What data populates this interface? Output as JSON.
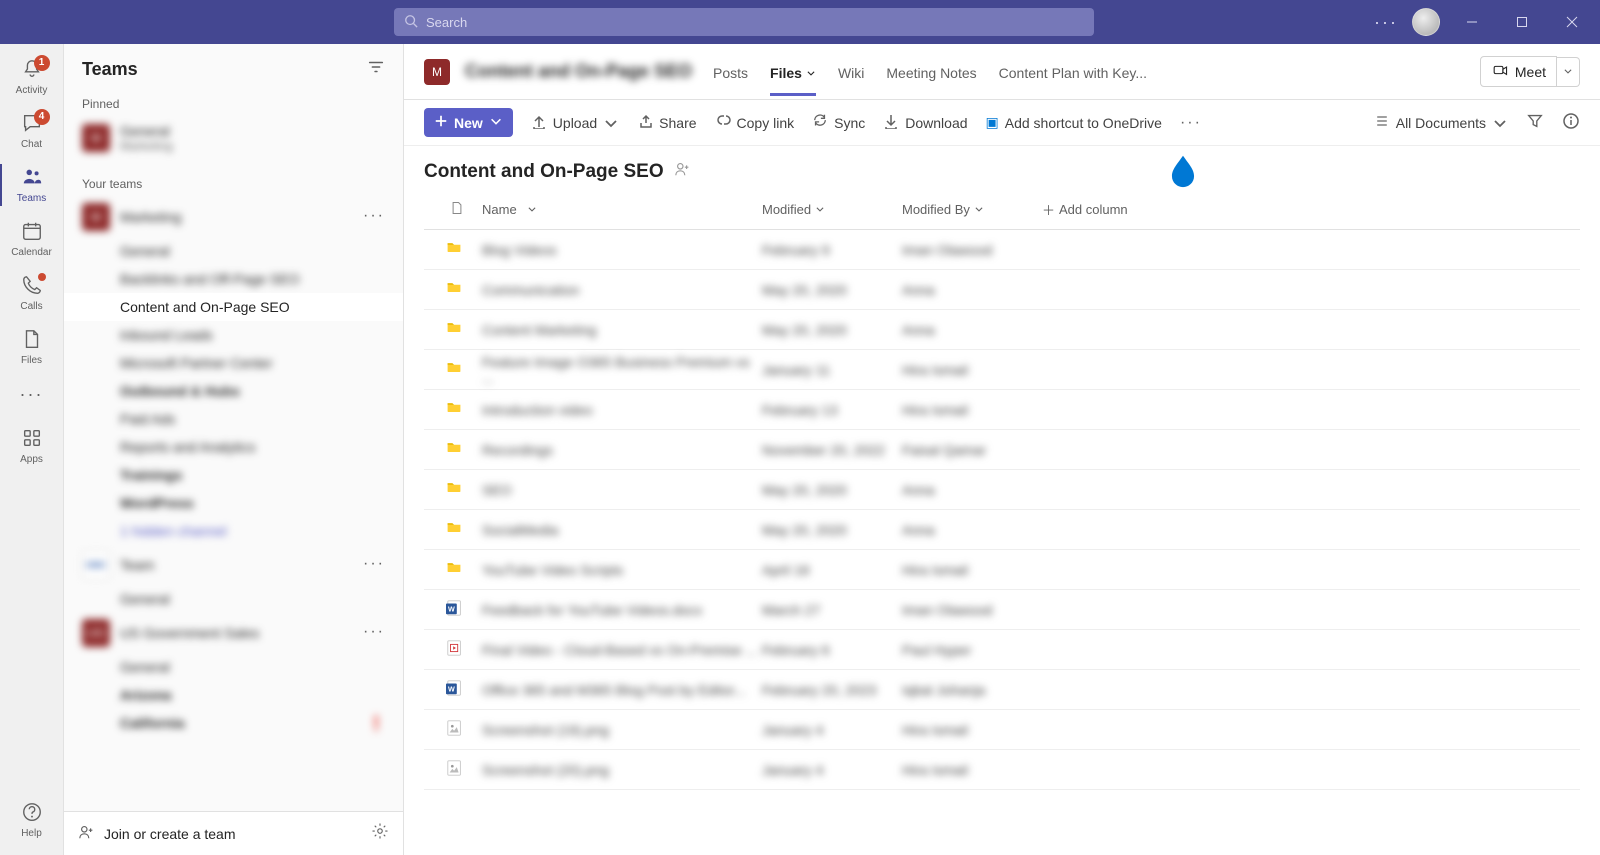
{
  "titlebar": {
    "search_placeholder": "Search"
  },
  "rail": {
    "activity": {
      "label": "Activity",
      "badge": "1"
    },
    "chat": {
      "label": "Chat",
      "badge": "4"
    },
    "teams": {
      "label": "Teams"
    },
    "calendar": {
      "label": "Calendar"
    },
    "calls": {
      "label": "Calls"
    },
    "files": {
      "label": "Files"
    },
    "apps": {
      "label": "Apps"
    },
    "help": {
      "label": "Help"
    }
  },
  "teams_panel": {
    "title": "Teams",
    "pinned_label": "Pinned",
    "pinned": [
      {
        "avatar": "M",
        "title": "General",
        "subtitle": "Marketing"
      }
    ],
    "your_teams_label": "Your teams",
    "groups": [
      {
        "avatar": "M",
        "name": "Marketing",
        "channels": [
          {
            "name": "General"
          },
          {
            "name": "Backlinks and Off-Page SEO"
          },
          {
            "name": "Content and On-Page SEO",
            "active": true
          },
          {
            "name": "Inbound Leads"
          },
          {
            "name": "Microsoft Partner Center"
          },
          {
            "name": "Outbound & Hubs",
            "bold": true
          },
          {
            "name": "Paid Ads"
          },
          {
            "name": "Reports and Analytics"
          },
          {
            "name": "Trainings",
            "bold": true
          },
          {
            "name": "WordPress",
            "bold": true
          },
          {
            "name": "1 hidden channel",
            "link": true
          }
        ]
      },
      {
        "avatar_style": "white",
        "avatar": "OMC",
        "name": "Team",
        "channels": [
          {
            "name": "General"
          }
        ]
      },
      {
        "avatar": "UG",
        "name": "US Government Sales",
        "channels": [
          {
            "name": "General"
          },
          {
            "name": "Arizona",
            "bold": true
          },
          {
            "name": "California",
            "bold": true,
            "alert": true
          }
        ]
      }
    ],
    "join_label": "Join or create a team"
  },
  "content_header": {
    "avatar": "M",
    "channel_name": "Content and On-Page SEO",
    "tabs": {
      "posts": "Posts",
      "files": "Files",
      "wiki": "Wiki",
      "notes": "Meeting Notes",
      "plan": "Content Plan with Key..."
    },
    "meet": "Meet"
  },
  "toolbar": {
    "new": "New",
    "upload": "Upload",
    "share": "Share",
    "copylink": "Copy link",
    "sync": "Sync",
    "download": "Download",
    "shortcut": "Add shortcut to OneDrive",
    "view": "All Documents"
  },
  "page": {
    "title": "Content and On-Page SEO"
  },
  "file_header": {
    "name": "Name",
    "modified": "Modified",
    "by": "Modified By",
    "add": "Add column"
  },
  "files": [
    {
      "type": "folder",
      "name": "Blog Videos",
      "modified": "February 9",
      "by": "Iman Olawood"
    },
    {
      "type": "folder",
      "name": "Communication",
      "modified": "May 20, 2020",
      "by": "Anna"
    },
    {
      "type": "folder",
      "name": "Content Marketing",
      "modified": "May 20, 2020",
      "by": "Anna"
    },
    {
      "type": "folder",
      "name": "Feature Image O365 Business Premium vs ...",
      "modified": "January 11",
      "by": "Hira Ismail"
    },
    {
      "type": "folder",
      "name": "Introduction video",
      "modified": "February 13",
      "by": "Hira Ismail"
    },
    {
      "type": "folder",
      "name": "Recordings",
      "modified": "November 20, 2022",
      "by": "Faisal Qamar"
    },
    {
      "type": "folder",
      "name": "SEO",
      "modified": "May 20, 2020",
      "by": "Anna"
    },
    {
      "type": "folder",
      "name": "SocialMedia",
      "modified": "May 20, 2020",
      "by": "Anna"
    },
    {
      "type": "folder",
      "name": "YouTube Video Scripts",
      "modified": "April 18",
      "by": "Hira Ismail"
    },
    {
      "type": "docx",
      "name": "Feedback for YouTube Videos.docx",
      "modified": "March 27",
      "by": "Iman Olawood"
    },
    {
      "type": "video",
      "name": "Final Video - Cloud-Based vs On-Premise ...",
      "modified": "February 6",
      "by": "Paul Hyper"
    },
    {
      "type": "docx",
      "name": "Office 365 and M365 Blog Post by Editor...",
      "modified": "February 20, 2023",
      "by": "Iqbal Johanja"
    },
    {
      "type": "image",
      "name": "Screenshot (19).png",
      "modified": "January 4",
      "by": "Hira Ismail"
    },
    {
      "type": "image",
      "name": "Screenshot (20).png",
      "modified": "January 4",
      "by": "Hira Ismail"
    }
  ]
}
